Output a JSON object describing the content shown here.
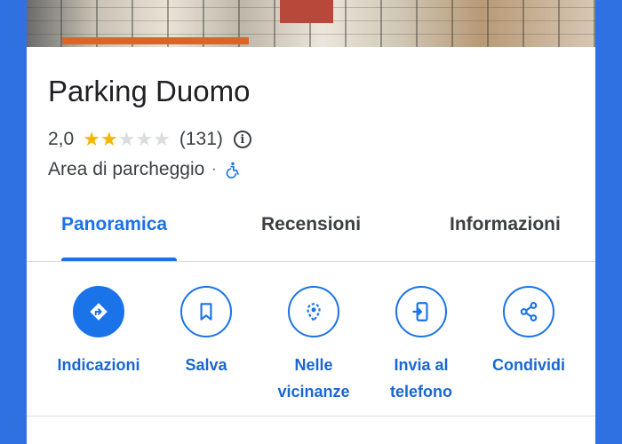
{
  "place": {
    "name": "Parking Duomo",
    "rating": "2,0",
    "stars_filled": 2,
    "stars_total": 5,
    "review_count": "(131)",
    "category": "Area di parcheggio",
    "separator": "·"
  },
  "tabs": [
    {
      "label": "Panoramica",
      "active": true
    },
    {
      "label": "Recensioni",
      "active": false
    },
    {
      "label": "Informazioni",
      "active": false
    }
  ],
  "actions": [
    {
      "label": "Indicazioni",
      "icon": "directions-icon"
    },
    {
      "label": "Salva",
      "icon": "bookmark-icon"
    },
    {
      "label": "Nelle vicinanze",
      "line1": "Nelle",
      "line2": "vicinanze",
      "icon": "nearby-icon"
    },
    {
      "label": "Invia al telefono",
      "line1": "Invia al",
      "line2": "telefono",
      "icon": "send-to-phone-icon"
    },
    {
      "label": "Condividi",
      "icon": "share-icon"
    }
  ],
  "colors": {
    "accent": "#1a73e8",
    "star": "#f7b500",
    "frame": "#2f71e0"
  }
}
